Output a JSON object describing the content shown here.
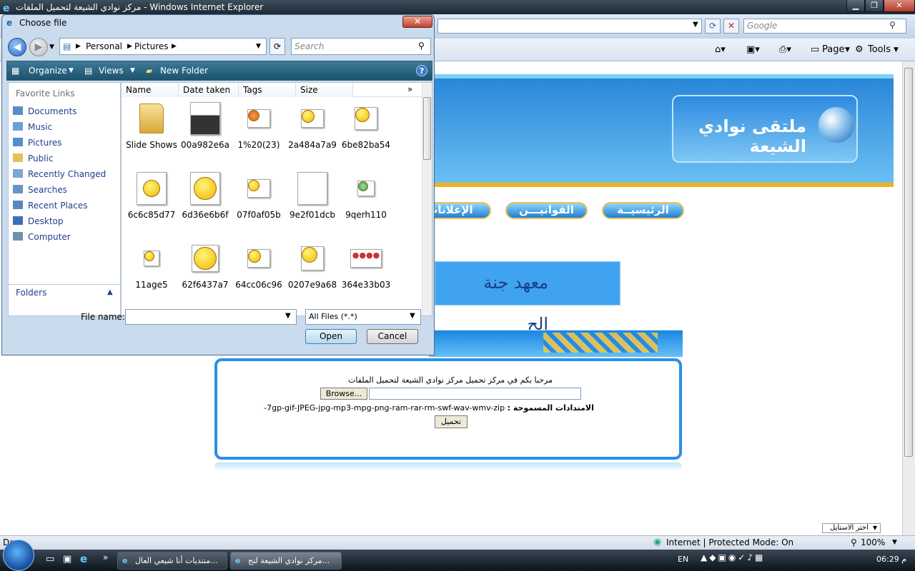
{
  "browser": {
    "window_title": "مركز نوادي الشيعة لتحميل الملفات - Windows Internet Explorer",
    "search_placeholder": "Google",
    "commands": {
      "page": "Page",
      "tools": "Tools"
    },
    "status_text": "Done",
    "zone_text": "Internet | Protected Mode: On",
    "zoom": "100%"
  },
  "webpage": {
    "logo_text": "ملتقى نوادي الشيعة",
    "nav": [
      "الرئيسيــة",
      "القوانيـــن",
      "الإعلانات"
    ],
    "sponsor_text": "معهد جنة الح",
    "welcome": "مرحبا بكم في مركز تحميل مركز نوادي الشيعة لتحميل الملفات",
    "browse_label": "Browse...",
    "extensions_label": "الامتدادات المسموحة :",
    "extensions_list": "7gp-gif-JPEG-jpg-mp3-mpg-png-ram-rar-rm-swf-wav-wmv-zip-",
    "upload_button": "تحميل",
    "style_select": "اختر الاستايل"
  },
  "dialog": {
    "title": "Choose file",
    "breadcrumb": [
      "Personal",
      "Pictures"
    ],
    "search_placeholder": "Search",
    "toolbar": {
      "organize": "Organize",
      "views": "Views",
      "new_folder": "New Folder"
    },
    "favorite_links_header": "Favorite Links",
    "favorite_links": [
      "Documents",
      "Music",
      "Pictures",
      "Public",
      "Recently Changed",
      "Searches",
      "Recent Places",
      "Desktop",
      "Computer"
    ],
    "folders_label": "Folders",
    "columns": [
      "Name",
      "Date taken",
      "Tags",
      "Size"
    ],
    "files": [
      "Slide Shows",
      "00a982e6a",
      "1%20(23)",
      "2a484a7a9",
      "6be82ba54",
      "6c6c85d77",
      "6d36e6b6f",
      "07f0af05b",
      "9e2f01dcb",
      "9qerh110",
      "11age5",
      "62f6437a7",
      "64cc06c96",
      "0207e9a68",
      "364e33b03"
    ],
    "file_name_label": "File name:",
    "file_name_value": "",
    "file_type": "All Files (*.*)",
    "open_label": "Open",
    "cancel_label": "Cancel"
  },
  "taskbar": {
    "items": [
      "منتديات أنا شيعي العال...",
      "مركز نوادي الشيعة لتح..."
    ],
    "language": "EN",
    "clock": "06:29 م"
  }
}
